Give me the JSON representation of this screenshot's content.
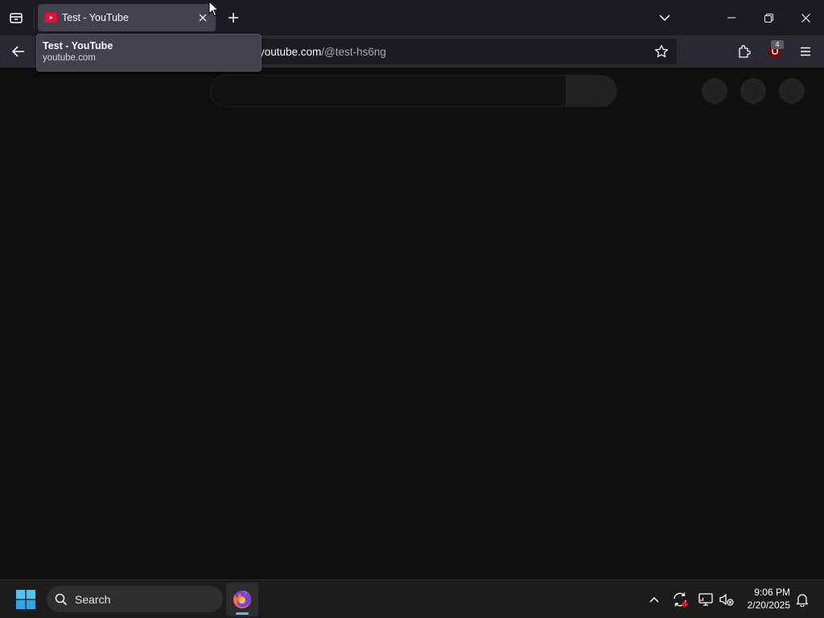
{
  "browser": {
    "tab": {
      "title": "Test - YouTube",
      "favicon": "youtube-icon"
    },
    "tooltip": {
      "title": "Test - YouTube",
      "url": "youtube.com"
    },
    "url": {
      "host": "youtube.com",
      "path": "/@test-hs6ng"
    },
    "extension_badge": "4",
    "icons": {
      "tab_list": "tab-list-icon",
      "new_tab": "plus-icon",
      "list_all_tabs": "chevron-down-icon",
      "minimize": "minimize-icon",
      "maximize": "restore-icon",
      "close": "close-icon",
      "back": "back-arrow-icon",
      "bookmark": "star-icon",
      "extensions": "puzzle-icon",
      "ublock": "ublock-origin-icon",
      "menu": "hamburger-menu-icon"
    },
    "colors": {
      "tabstrip": "#1c1b22",
      "navbar": "#2b2a33",
      "active_tab": "#42414d",
      "page_bg": "#0f0f0f",
      "youtube_red": "#ff0033"
    }
  },
  "taskbar": {
    "search_label": "Search",
    "time": "9:06 PM",
    "date": "2/20/2025",
    "pinned_app": "firefox-icon",
    "accent": "#4cc2ff"
  }
}
